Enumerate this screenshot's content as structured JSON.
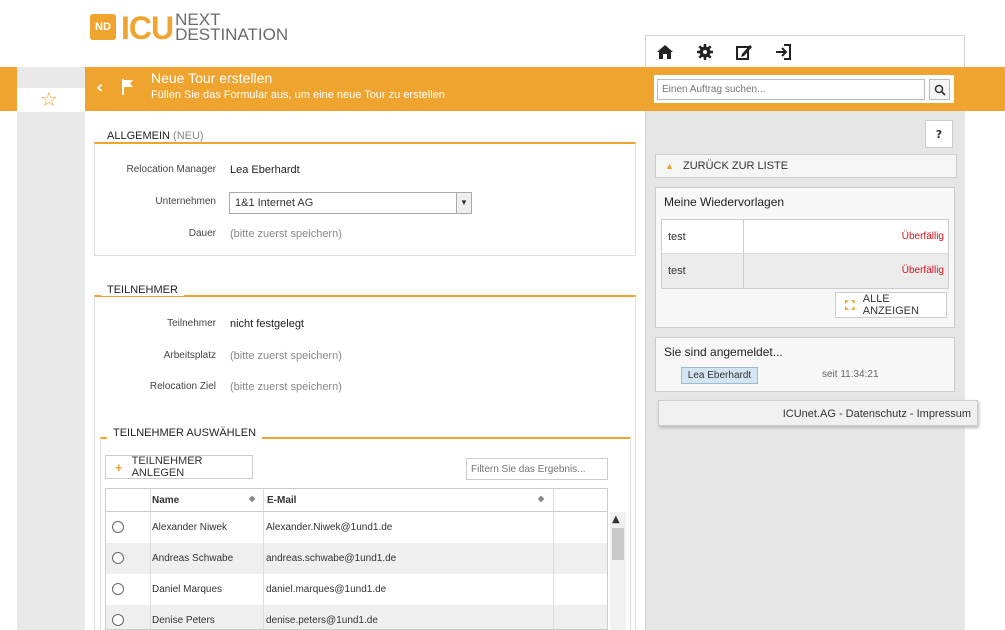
{
  "logo": {
    "badge": "ND",
    "brand": "ICU",
    "line1": "NEXT",
    "line2": "DESTINATION"
  },
  "toolbar": {
    "icons": [
      "home-icon",
      "gear-icon",
      "edit-icon",
      "logout-icon"
    ]
  },
  "header": {
    "title": "Neue Tour erstellen",
    "subtitle": "Füllen Sie das Formular aus, um eine neue Tour zu erstellen"
  },
  "search": {
    "placeholder": "Einen Auftrag suchen..."
  },
  "general": {
    "legend": "ALLGEMEIN",
    "legend_tag": "(NEU)",
    "fields": [
      {
        "label": "Relocation Manager",
        "value": "Lea Eberhardt"
      },
      {
        "label": "Unternehmen",
        "value": "1&1 Internet AG"
      },
      {
        "label": "Dauer",
        "value": "(bitte zuerst speichern)"
      }
    ]
  },
  "participants": {
    "legend": "TEILNEHMER",
    "fields": [
      {
        "label": "Teilnehmer",
        "value": "nicht festgelegt"
      },
      {
        "label": "Arbeitsplatz",
        "value": "(bitte zuerst speichern)"
      },
      {
        "label": "Relocation Ziel",
        "value": "(bitte zuerst speichern)"
      }
    ]
  },
  "select_participants": {
    "legend": "TEILNEHMER AUSWÄHLEN",
    "add_button": "TEILNEHMER ANLEGEN",
    "filter_placeholder": "Filtern Sie das Ergebnis...",
    "columns": [
      "Name",
      "E-Mail"
    ],
    "rows": [
      {
        "name": "Alexander Niwek",
        "email": "Alexander.Niwek@1und1.de"
      },
      {
        "name": "Andreas Schwabe",
        "email": "andreas.schwabe@1und1.de"
      },
      {
        "name": "Daniel Marques",
        "email": "daniel.marques@1und1.de"
      },
      {
        "name": "Denise Peters",
        "email": "denise.peters@1und1.de"
      }
    ]
  },
  "sidebar": {
    "help": "?",
    "back_to_list": "ZURÜCK ZUR LISTE",
    "reminders_title": "Meine Wiedervorlagen",
    "reminders": [
      {
        "name": "test",
        "status": "Überfällig"
      },
      {
        "name": "test",
        "status": "Überfällig"
      }
    ],
    "show_all": "ALLE ANZEIGEN",
    "logged_in_title": "Sie sind angemeldet...",
    "user": "Lea Eberhardt",
    "since": "seit 11:34:21",
    "footer": "ICUnet.AG - Datenschutz - Impressum"
  },
  "colors": {
    "accent": "#eea42e",
    "overdue": "#d4121b"
  }
}
